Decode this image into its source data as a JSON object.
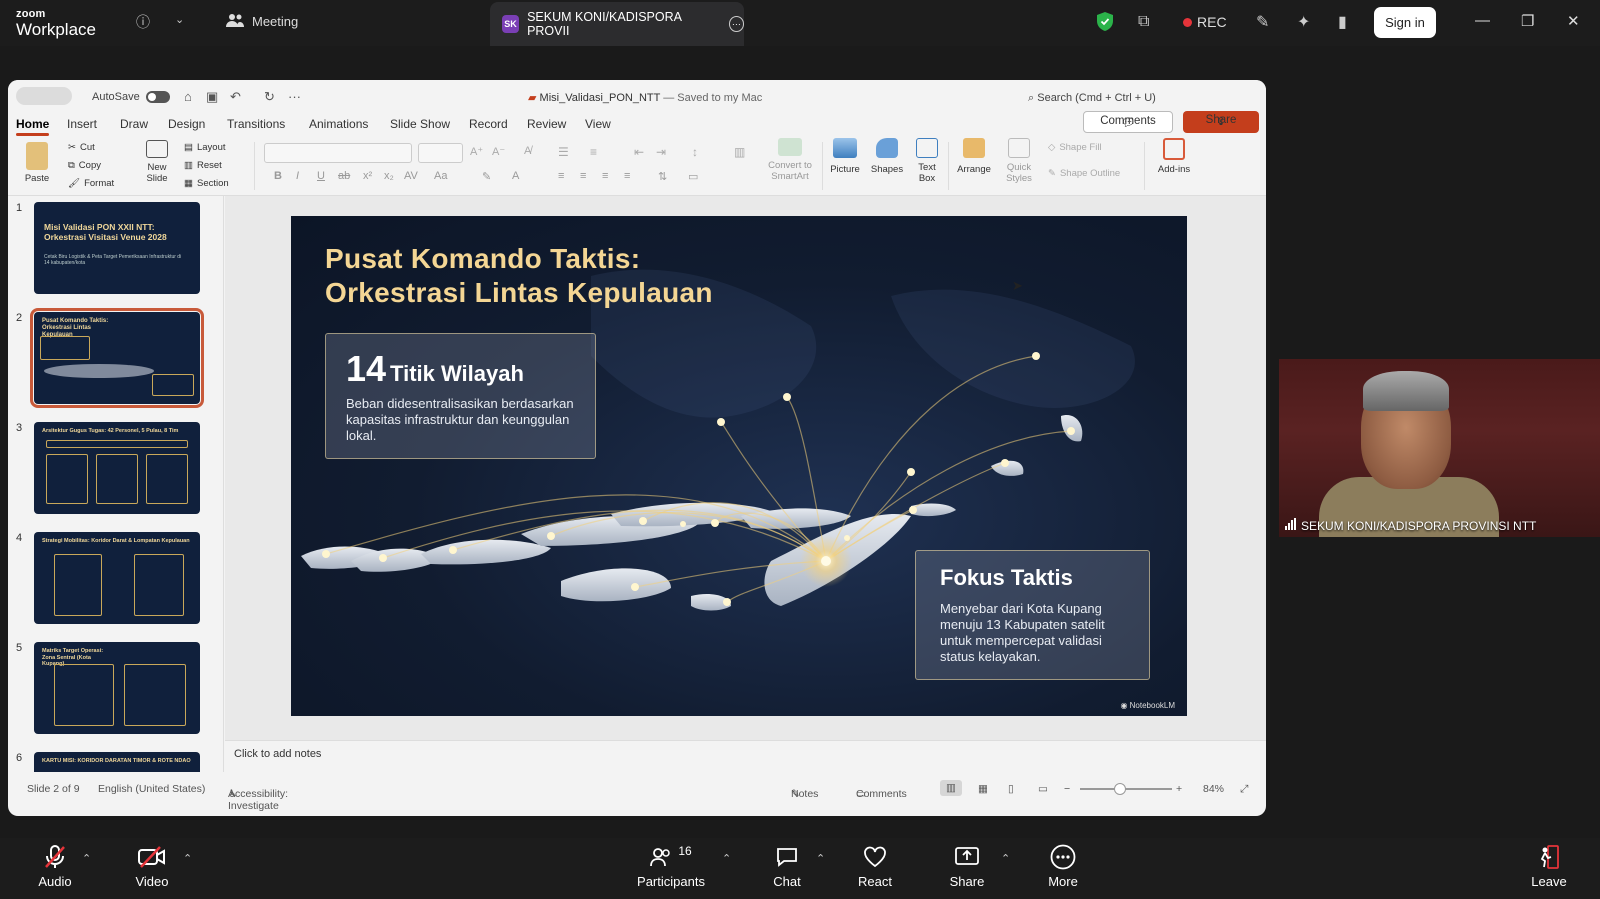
{
  "zoom": {
    "logo_line1": "zoom",
    "logo_line2": "Workplace",
    "meeting_label": "Meeting",
    "tab_badge": "SK",
    "tab_title": "SEKUM KONI/KADISPORA PROVII",
    "rec_label": "REC",
    "signin_label": "Sign in",
    "bottom": {
      "audio": "Audio",
      "video": "Video",
      "participants": "Participants",
      "participants_count": "16",
      "chat": "Chat",
      "react": "React",
      "share": "Share",
      "more": "More",
      "leave": "Leave"
    },
    "participant_name": "SEKUM KONI/KADISPORA PROVINSI NTT"
  },
  "ppt": {
    "autosave": "AutoSave",
    "doc_name": "Misi_Validasi_PON_NTT",
    "doc_status": "— Saved to my Mac",
    "search": "Search (Cmd + Ctrl + U)",
    "tabs": [
      "Home",
      "Insert",
      "Draw",
      "Design",
      "Transitions",
      "Animations",
      "Slide Show",
      "Record",
      "Review",
      "View"
    ],
    "comments_btn": "Comments",
    "share_btn": "Share",
    "ribbon": {
      "paste": "Paste",
      "cut": "Cut",
      "copy": "Copy",
      "format": "Format",
      "new_slide_1": "New",
      "new_slide_2": "Slide",
      "layout": "Layout",
      "reset": "Reset",
      "section": "Section",
      "convert_1": "Convert to",
      "convert_2": "SmartArt",
      "picture": "Picture",
      "shapes": "Shapes",
      "textbox_1": "Text",
      "textbox_2": "Box",
      "arrange": "Arrange",
      "quick_1": "Quick",
      "quick_2": "Styles",
      "shape_fill": "Shape Fill",
      "shape_outline": "Shape Outline",
      "addins": "Add-ins"
    },
    "thumbnails": [
      {
        "num": "1",
        "title": "Misi Validasi PON XXII NTT: Orkestrasi Visitasi Venue 2028",
        "sub": "Cetak Biru Logistik & Peta Target Pemeriksaan Infrastruktur di 14 kabupaten/kota"
      },
      {
        "num": "2",
        "title": "Pusat Komando Taktis: Orkestrasi Lintas Kepulauan"
      },
      {
        "num": "3",
        "title": "Arsitektur Gugus Tugas: 42 Personel, 5 Pulau, 8 Tim"
      },
      {
        "num": "4",
        "title": "Strategi Mobilitas: Koridor Darat & Lompatan Kepulauan"
      },
      {
        "num": "5",
        "title": "Matriks Target Operasi: Zona Sentral (Kota Kupang)"
      },
      {
        "num": "6",
        "title": "KARTU MISI: KORIDOR DARATAN TIMOR & ROTE NDAO"
      }
    ],
    "slide": {
      "title_line1": "Pusat Komando Taktis:",
      "title_line2": "Orkestrasi Lintas Kepulauan",
      "card1_num": "14",
      "card1_head": "Titik Wilayah",
      "card1_body": "Beban didesentralisasikan berdasarkan kapasitas infrastruktur dan keunggulan lokal.",
      "card2_head": "Fokus Taktis",
      "card2_body": "Menyebar dari Kota Kupang menuju 13 Kabupaten satelit untuk mempercepat validasi status kelayakan.",
      "watermark": "NotebookLM"
    },
    "notes_placeholder": "Click to add notes",
    "status": {
      "slide_info": "Slide 2 of 9",
      "language": "English (United States)",
      "accessibility": "Accessibility: Investigate",
      "notes": "Notes",
      "comments": "Comments",
      "zoom": "84%"
    }
  }
}
